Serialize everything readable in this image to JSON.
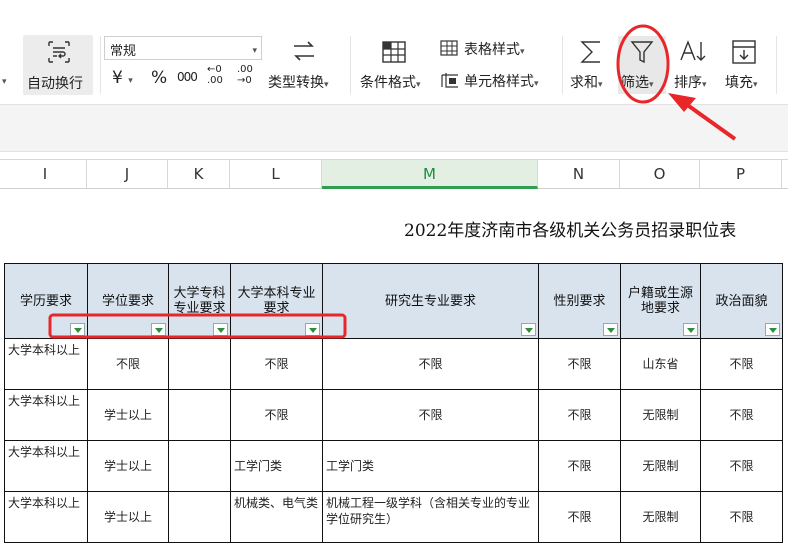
{
  "ribbon": {
    "wrap_text": "自动换行",
    "number_format": "常规",
    "currency_symbol": "¥",
    "percent_symbol": "%",
    "thousands_symbol": "000",
    "decimal_inc": "←0 .00",
    "decimal_dec": ".00 →0",
    "type_convert": "类型转换",
    "cond_format": "条件格式",
    "table_style": "表格样式",
    "cell_style": "单元格样式",
    "sum": "求和",
    "filter": "筛选",
    "sort": "排序",
    "fill": "填充"
  },
  "columns": [
    "I",
    "J",
    "K",
    "L",
    "M",
    "N",
    "O",
    "P"
  ],
  "selected_column": "M",
  "sheet_title": "2022年度济南市各级机关公务员招录职位表",
  "headers": [
    "学历要求",
    "学位要求",
    "大学专科专业要求",
    "大学本科专业要求",
    "研究生专业要求",
    "性别要求",
    "户籍或生源地要求",
    "政治面貌"
  ],
  "rows": [
    [
      "大学本科以上",
      "不限",
      "",
      "不限",
      "不限",
      "不限",
      "山东省",
      "不限"
    ],
    [
      "大学本科以上",
      "学士以上",
      "",
      "不限",
      "不限",
      "不限",
      "无限制",
      "不限"
    ],
    [
      "大学本科以上",
      "学士以上",
      "",
      "工学门类",
      "工学门类",
      "不限",
      "无限制",
      "不限"
    ],
    [
      "大学本科以上",
      "学士以上",
      "",
      "机械类、电气类",
      "机械工程一级学科（含相关专业的专业学位研究生）",
      "不限",
      "无限制",
      "不限"
    ]
  ],
  "annotation_color": "#e8272b",
  "header_fill": "#d8e3ee"
}
